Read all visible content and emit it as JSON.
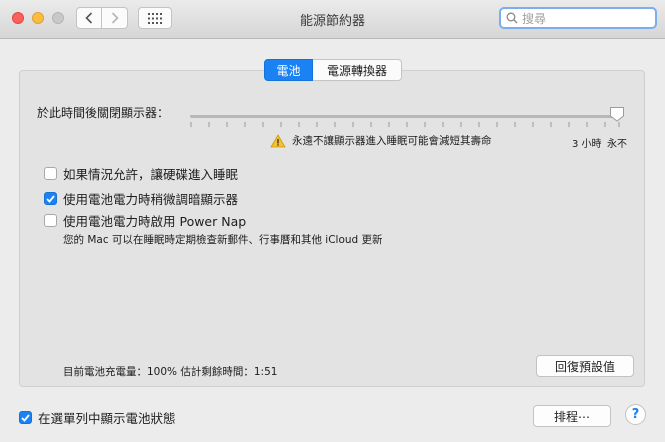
{
  "window": {
    "title": "能源節約器",
    "search_placeholder": "搜尋"
  },
  "tabs": [
    {
      "label": "電池",
      "selected": true
    },
    {
      "label": "電源轉換器",
      "selected": false
    }
  ],
  "display_sleep": {
    "label": "於此時間後關閉顯示器：",
    "value": "永不",
    "warning": "永遠不讓顯示器進入睡眠可能會減短其壽命",
    "tick_labels": [
      "3 小時",
      "永不"
    ]
  },
  "options": [
    {
      "label": "如果情況允許，讓硬碟進入睡眠",
      "checked": false
    },
    {
      "label": "使用電池電力時稍微調暗顯示器",
      "checked": true
    },
    {
      "label": "使用電池電力時啟用 Power Nap",
      "checked": false
    }
  ],
  "power_nap_note": "您的 Mac 可以在睡眠時定期檢查新郵件、行事曆和其他 iCloud 更新",
  "battery_status": "目前電池充電量：100%  估計剩餘時間：1:51",
  "buttons": {
    "restore_defaults": "回復預設值",
    "schedule": "排程⋯",
    "help": "?"
  },
  "menu_bar_option": {
    "label": "在選單列中顯示電池狀態",
    "checked": true
  },
  "colors": {
    "accent": "#1b82f3",
    "close": "#fc605b",
    "minimize": "#fdbc40",
    "warning": "#f5c12e"
  }
}
